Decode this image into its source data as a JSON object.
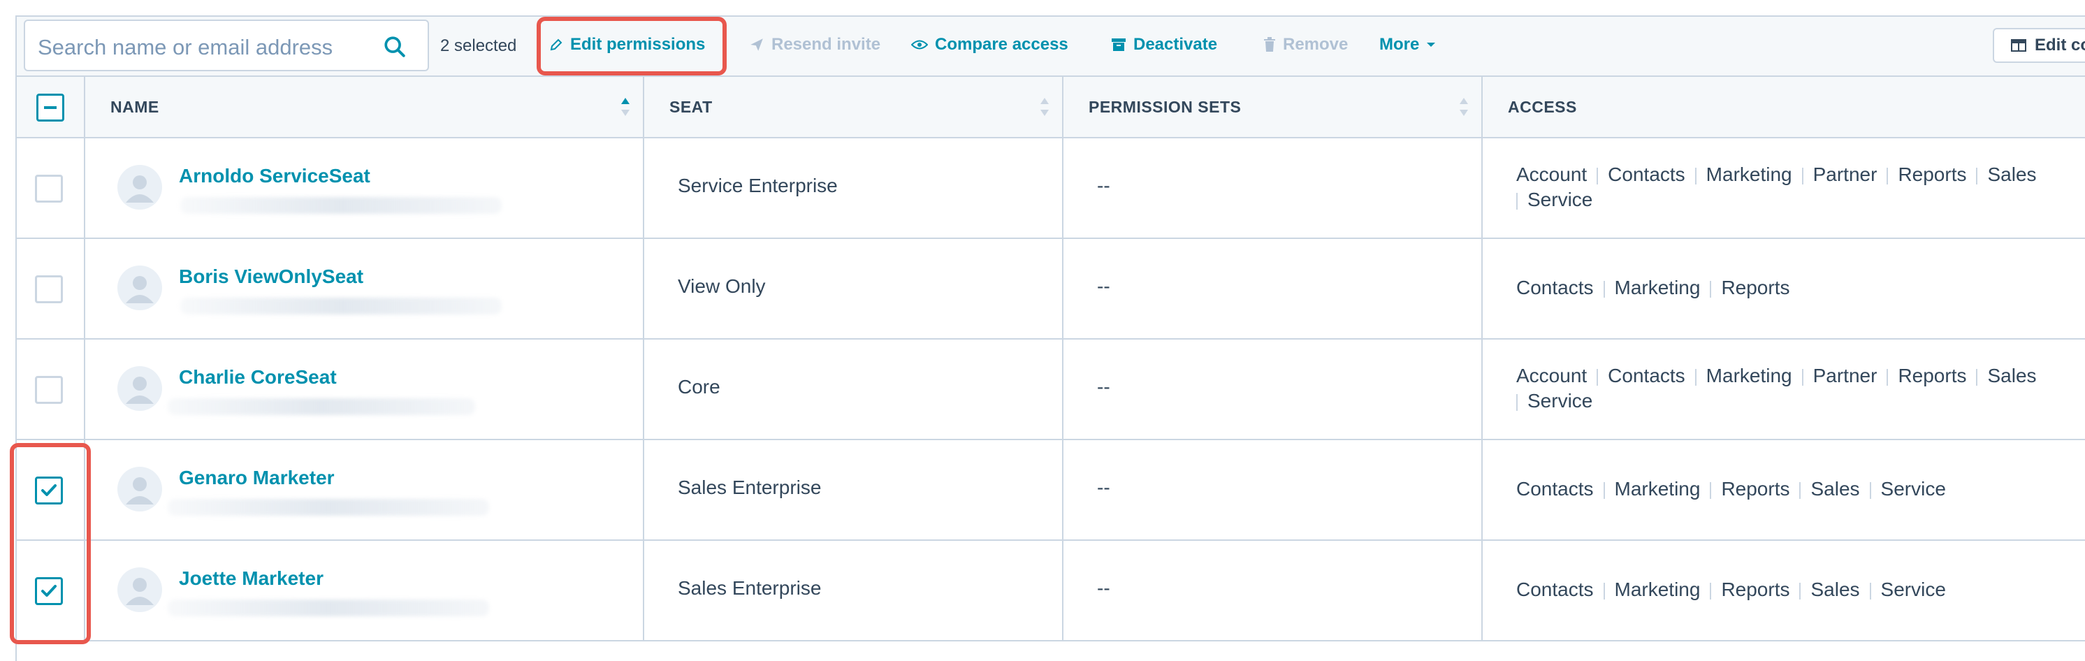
{
  "toolbar": {
    "search_placeholder": "Search name or email address",
    "selected_count": "2 selected",
    "edit_permissions": "Edit permissions",
    "resend_invite": "Resend invite",
    "compare_access": "Compare access",
    "deactivate": "Deactivate",
    "remove": "Remove",
    "more": "More",
    "edit_columns": "Edit columns"
  },
  "table": {
    "headers": {
      "name": "NAME",
      "seat": "SEAT",
      "permission_sets": "PERMISSION SETS",
      "access": "ACCESS"
    },
    "rows": [
      {
        "name": "Arnoldo ServiceSeat",
        "seat": "Service Enterprise",
        "permission_sets": "--",
        "checked": false,
        "access_line1": [
          "Account",
          "Contacts",
          "Marketing",
          "Partner",
          "Reports",
          "Sales"
        ],
        "access_line2": [
          "Service"
        ]
      },
      {
        "name": "Boris ViewOnlySeat",
        "seat": "View Only",
        "permission_sets": "--",
        "checked": false,
        "access_line1": [
          "Contacts",
          "Marketing",
          "Reports"
        ],
        "access_line2": []
      },
      {
        "name": "Charlie CoreSeat",
        "seat": "Core",
        "permission_sets": "--",
        "checked": false,
        "access_line1": [
          "Account",
          "Contacts",
          "Marketing",
          "Partner",
          "Reports",
          "Sales"
        ],
        "access_line2": [
          "Service"
        ]
      },
      {
        "name": "Genaro Marketer",
        "seat": "Sales Enterprise",
        "permission_sets": "--",
        "checked": true,
        "access_line1": [
          "Contacts",
          "Marketing",
          "Reports",
          "Sales",
          "Service"
        ],
        "access_line2": []
      },
      {
        "name": "Joette Marketer",
        "seat": "Sales Enterprise",
        "permission_sets": "--",
        "checked": true,
        "access_line1": [
          "Contacts",
          "Marketing",
          "Reports",
          "Sales",
          "Service"
        ],
        "access_line2": []
      }
    ]
  },
  "colors": {
    "accent": "#0091ae",
    "text": "#33475b",
    "disabled": "#b0c1d4",
    "border": "#cbd6e2",
    "header_bg": "#f5f8fa",
    "highlight": "#e8574d"
  }
}
